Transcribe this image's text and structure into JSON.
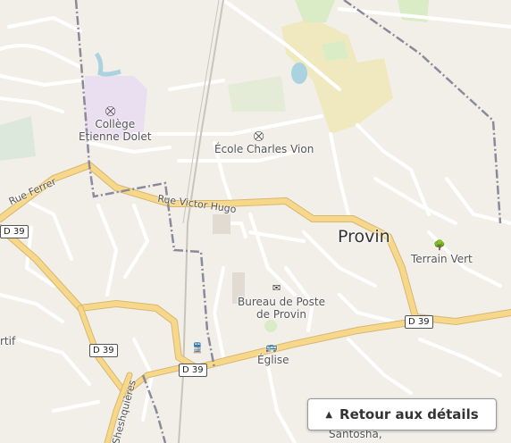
{
  "labels": {
    "college": "Collège\nEtienne Dolet",
    "ecole": "École Charles Vion",
    "town": "Provin",
    "terrain": "Terrain Vert",
    "poste": "Bureau de Poste\nde Provin",
    "eglise": "Église",
    "santosha": "Santosha,",
    "rtif": "rtif"
  },
  "roads": {
    "rue_ferrer": "Rue Ferrer",
    "rue_victor_hugo": "Rue Victor Hugo",
    "rue_sheshquieres": "Sheshquières",
    "d39_a": "D 39",
    "d39_b": "D 39",
    "d39_c": "D 39",
    "d39_d": "D 39"
  },
  "icons": {
    "school": "school-icon",
    "school2": "school-icon",
    "post": "post-office-icon",
    "bus": "bus-stop-icon",
    "rail": "railway-icon",
    "tree": "tree-icon"
  },
  "button": {
    "arrow": "▲",
    "label": "Retour aux détails"
  },
  "colors": {
    "background": "#f2efe9",
    "road_major": "#f7d88a",
    "road_minor": "#ffffff",
    "school_area": "#e9dff0",
    "residential": "#f0e9c0",
    "park": "#d9ecc6",
    "water": "#aad3df",
    "boundary": "#8a8a9a"
  }
}
